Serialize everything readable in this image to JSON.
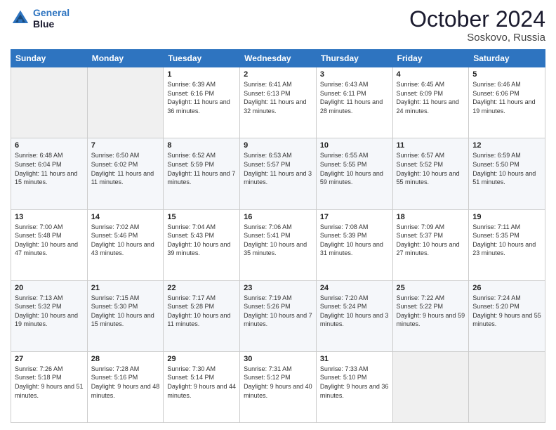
{
  "header": {
    "logo_line1": "General",
    "logo_line2": "Blue",
    "month_title": "October 2024",
    "location": "Soskovo, Russia"
  },
  "weekdays": [
    "Sunday",
    "Monday",
    "Tuesday",
    "Wednesday",
    "Thursday",
    "Friday",
    "Saturday"
  ],
  "weeks": [
    [
      {
        "day": "",
        "sunrise": "",
        "sunset": "",
        "daylight": ""
      },
      {
        "day": "",
        "sunrise": "",
        "sunset": "",
        "daylight": ""
      },
      {
        "day": "1",
        "sunrise": "Sunrise: 6:39 AM",
        "sunset": "Sunset: 6:16 PM",
        "daylight": "Daylight: 11 hours and 36 minutes."
      },
      {
        "day": "2",
        "sunrise": "Sunrise: 6:41 AM",
        "sunset": "Sunset: 6:13 PM",
        "daylight": "Daylight: 11 hours and 32 minutes."
      },
      {
        "day": "3",
        "sunrise": "Sunrise: 6:43 AM",
        "sunset": "Sunset: 6:11 PM",
        "daylight": "Daylight: 11 hours and 28 minutes."
      },
      {
        "day": "4",
        "sunrise": "Sunrise: 6:45 AM",
        "sunset": "Sunset: 6:09 PM",
        "daylight": "Daylight: 11 hours and 24 minutes."
      },
      {
        "day": "5",
        "sunrise": "Sunrise: 6:46 AM",
        "sunset": "Sunset: 6:06 PM",
        "daylight": "Daylight: 11 hours and 19 minutes."
      }
    ],
    [
      {
        "day": "6",
        "sunrise": "Sunrise: 6:48 AM",
        "sunset": "Sunset: 6:04 PM",
        "daylight": "Daylight: 11 hours and 15 minutes."
      },
      {
        "day": "7",
        "sunrise": "Sunrise: 6:50 AM",
        "sunset": "Sunset: 6:02 PM",
        "daylight": "Daylight: 11 hours and 11 minutes."
      },
      {
        "day": "8",
        "sunrise": "Sunrise: 6:52 AM",
        "sunset": "Sunset: 5:59 PM",
        "daylight": "Daylight: 11 hours and 7 minutes."
      },
      {
        "day": "9",
        "sunrise": "Sunrise: 6:53 AM",
        "sunset": "Sunset: 5:57 PM",
        "daylight": "Daylight: 11 hours and 3 minutes."
      },
      {
        "day": "10",
        "sunrise": "Sunrise: 6:55 AM",
        "sunset": "Sunset: 5:55 PM",
        "daylight": "Daylight: 10 hours and 59 minutes."
      },
      {
        "day": "11",
        "sunrise": "Sunrise: 6:57 AM",
        "sunset": "Sunset: 5:52 PM",
        "daylight": "Daylight: 10 hours and 55 minutes."
      },
      {
        "day": "12",
        "sunrise": "Sunrise: 6:59 AM",
        "sunset": "Sunset: 5:50 PM",
        "daylight": "Daylight: 10 hours and 51 minutes."
      }
    ],
    [
      {
        "day": "13",
        "sunrise": "Sunrise: 7:00 AM",
        "sunset": "Sunset: 5:48 PM",
        "daylight": "Daylight: 10 hours and 47 minutes."
      },
      {
        "day": "14",
        "sunrise": "Sunrise: 7:02 AM",
        "sunset": "Sunset: 5:46 PM",
        "daylight": "Daylight: 10 hours and 43 minutes."
      },
      {
        "day": "15",
        "sunrise": "Sunrise: 7:04 AM",
        "sunset": "Sunset: 5:43 PM",
        "daylight": "Daylight: 10 hours and 39 minutes."
      },
      {
        "day": "16",
        "sunrise": "Sunrise: 7:06 AM",
        "sunset": "Sunset: 5:41 PM",
        "daylight": "Daylight: 10 hours and 35 minutes."
      },
      {
        "day": "17",
        "sunrise": "Sunrise: 7:08 AM",
        "sunset": "Sunset: 5:39 PM",
        "daylight": "Daylight: 10 hours and 31 minutes."
      },
      {
        "day": "18",
        "sunrise": "Sunrise: 7:09 AM",
        "sunset": "Sunset: 5:37 PM",
        "daylight": "Daylight: 10 hours and 27 minutes."
      },
      {
        "day": "19",
        "sunrise": "Sunrise: 7:11 AM",
        "sunset": "Sunset: 5:35 PM",
        "daylight": "Daylight: 10 hours and 23 minutes."
      }
    ],
    [
      {
        "day": "20",
        "sunrise": "Sunrise: 7:13 AM",
        "sunset": "Sunset: 5:32 PM",
        "daylight": "Daylight: 10 hours and 19 minutes."
      },
      {
        "day": "21",
        "sunrise": "Sunrise: 7:15 AM",
        "sunset": "Sunset: 5:30 PM",
        "daylight": "Daylight: 10 hours and 15 minutes."
      },
      {
        "day": "22",
        "sunrise": "Sunrise: 7:17 AM",
        "sunset": "Sunset: 5:28 PM",
        "daylight": "Daylight: 10 hours and 11 minutes."
      },
      {
        "day": "23",
        "sunrise": "Sunrise: 7:19 AM",
        "sunset": "Sunset: 5:26 PM",
        "daylight": "Daylight: 10 hours and 7 minutes."
      },
      {
        "day": "24",
        "sunrise": "Sunrise: 7:20 AM",
        "sunset": "Sunset: 5:24 PM",
        "daylight": "Daylight: 10 hours and 3 minutes."
      },
      {
        "day": "25",
        "sunrise": "Sunrise: 7:22 AM",
        "sunset": "Sunset: 5:22 PM",
        "daylight": "Daylight: 9 hours and 59 minutes."
      },
      {
        "day": "26",
        "sunrise": "Sunrise: 7:24 AM",
        "sunset": "Sunset: 5:20 PM",
        "daylight": "Daylight: 9 hours and 55 minutes."
      }
    ],
    [
      {
        "day": "27",
        "sunrise": "Sunrise: 7:26 AM",
        "sunset": "Sunset: 5:18 PM",
        "daylight": "Daylight: 9 hours and 51 minutes."
      },
      {
        "day": "28",
        "sunrise": "Sunrise: 7:28 AM",
        "sunset": "Sunset: 5:16 PM",
        "daylight": "Daylight: 9 hours and 48 minutes."
      },
      {
        "day": "29",
        "sunrise": "Sunrise: 7:30 AM",
        "sunset": "Sunset: 5:14 PM",
        "daylight": "Daylight: 9 hours and 44 minutes."
      },
      {
        "day": "30",
        "sunrise": "Sunrise: 7:31 AM",
        "sunset": "Sunset: 5:12 PM",
        "daylight": "Daylight: 9 hours and 40 minutes."
      },
      {
        "day": "31",
        "sunrise": "Sunrise: 7:33 AM",
        "sunset": "Sunset: 5:10 PM",
        "daylight": "Daylight: 9 hours and 36 minutes."
      },
      {
        "day": "",
        "sunrise": "",
        "sunset": "",
        "daylight": ""
      },
      {
        "day": "",
        "sunrise": "",
        "sunset": "",
        "daylight": ""
      }
    ]
  ]
}
